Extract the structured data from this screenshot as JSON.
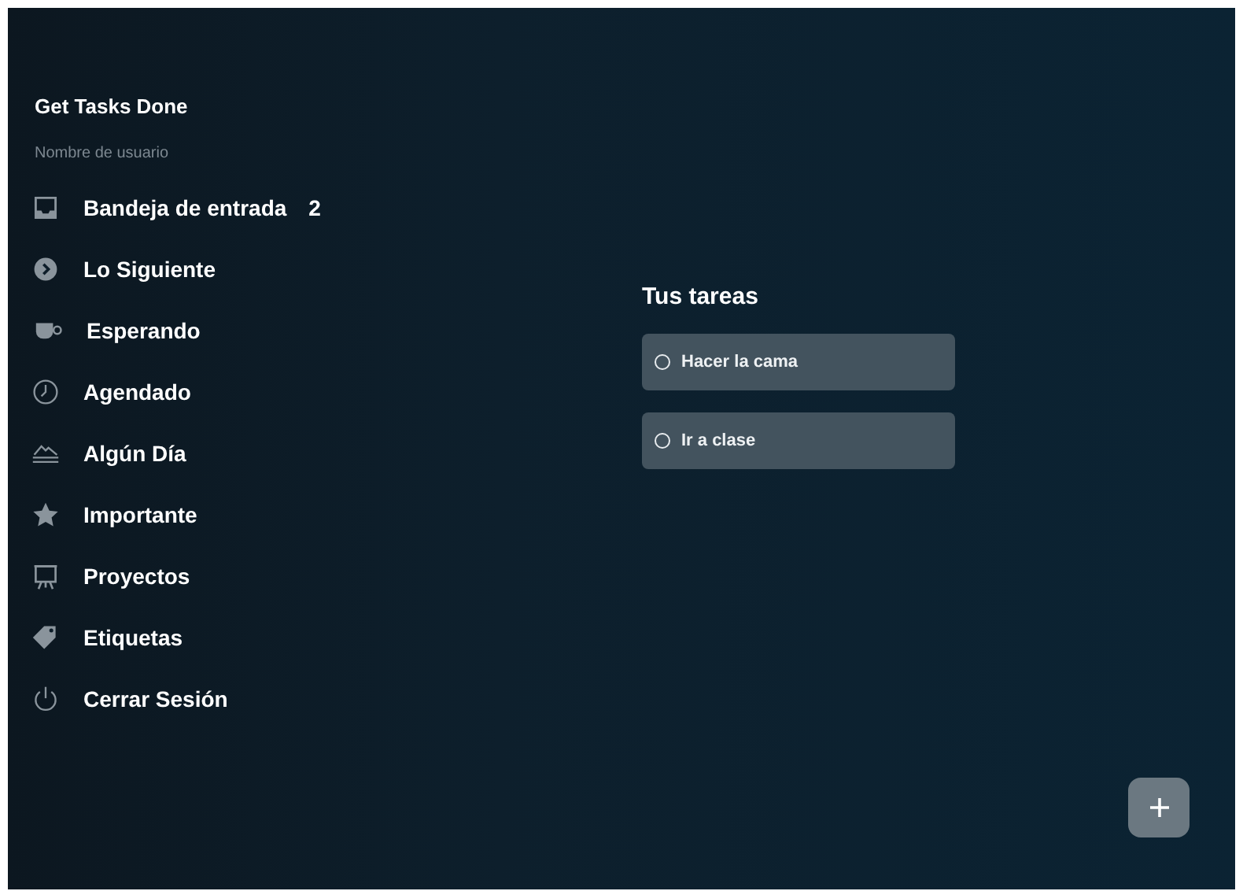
{
  "sidebar": {
    "app_title": "Get Tasks Done",
    "username": "Nombre de usuario",
    "items": [
      {
        "kind": "inbox",
        "label": "Bandeja de entrada",
        "count": "2"
      },
      {
        "kind": "next",
        "label": "Lo Siguiente"
      },
      {
        "kind": "waiting",
        "label": "Esperando"
      },
      {
        "kind": "scheduled",
        "label": "Agendado"
      },
      {
        "kind": "someday",
        "label": "Algún Día"
      },
      {
        "kind": "important",
        "label": "Importante"
      },
      {
        "kind": "projects",
        "label": "Proyectos"
      },
      {
        "kind": "tags",
        "label": "Etiquetas"
      },
      {
        "kind": "logout",
        "label": "Cerrar Sesión"
      }
    ]
  },
  "main": {
    "heading": "Tus tareas",
    "tasks": [
      {
        "label": "Hacer la cama",
        "checked": false
      },
      {
        "label": "Ir a clase",
        "checked": false
      }
    ]
  },
  "add_button": {
    "kind": "plus"
  }
}
